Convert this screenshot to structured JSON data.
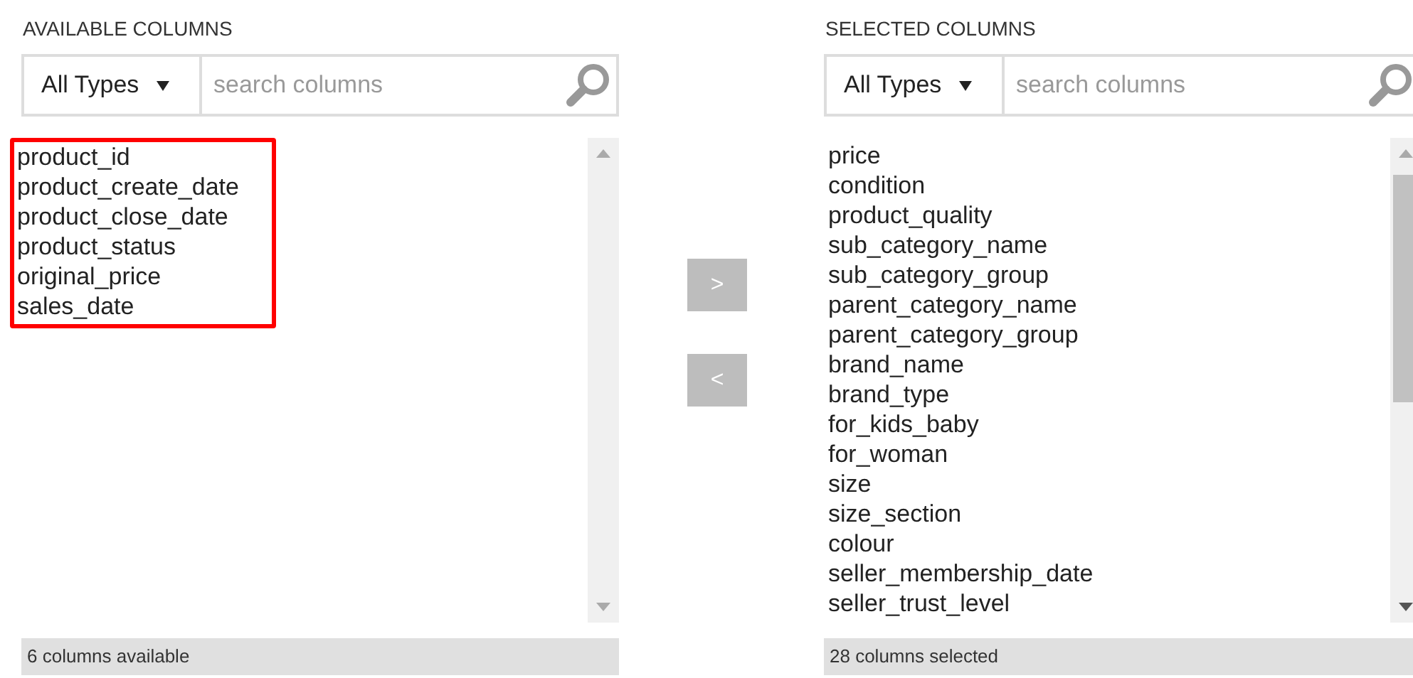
{
  "panels": [
    {
      "title": "AVAILABLE COLUMNS",
      "type_filter": "All Types",
      "search": {
        "placeholder": "search columns"
      },
      "highlighted": true,
      "scroll_thumb": false,
      "items": [
        "product_id",
        "product_create_date",
        "product_close_date",
        "product_status",
        "original_price",
        "sales_date"
      ],
      "footer": "6 columns available"
    },
    {
      "title": "SELECTED COLUMNS",
      "type_filter": "All Types",
      "search": {
        "placeholder": "search columns"
      },
      "highlighted": false,
      "scroll_thumb": true,
      "items": [
        "price",
        "condition",
        "product_quality",
        "sub_category_name",
        "sub_category_group",
        "parent_category_name",
        "parent_category_group",
        "brand_name",
        "brand_type",
        "for_kids_baby",
        "for_woman",
        "size",
        "size_section",
        "colour",
        "seller_membership_date",
        "seller_trust_level"
      ],
      "footer": "28 columns selected"
    }
  ],
  "move_buttons": [
    ">",
    "<"
  ]
}
